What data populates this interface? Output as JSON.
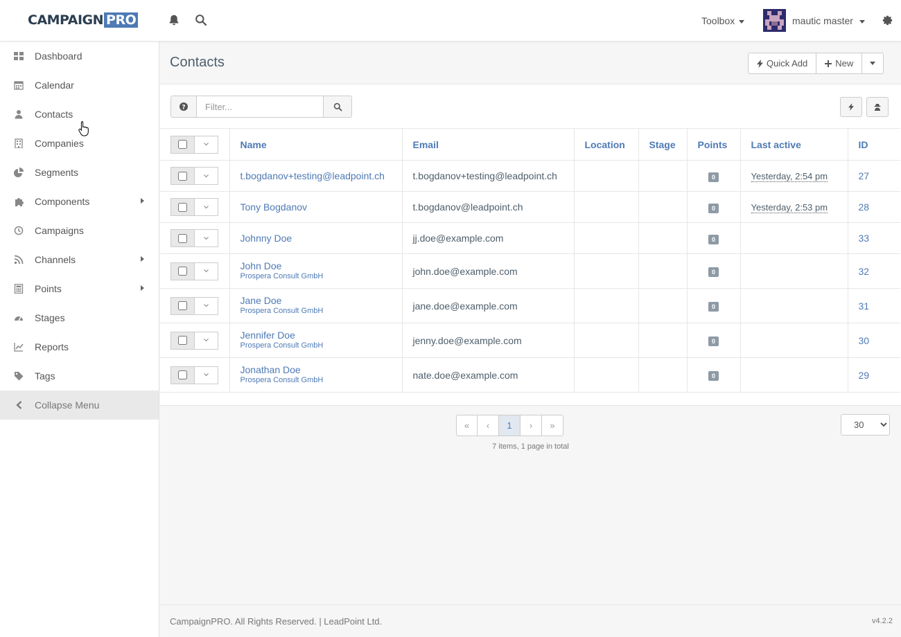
{
  "brand": {
    "name_a": "CAMPAIGN",
    "name_b": "PRO"
  },
  "header": {
    "toolbox_label": "Toolbox",
    "user_name": "mautic master"
  },
  "sidebar": {
    "items": [
      {
        "label": "Dashboard",
        "icon": "dashboard-icon"
      },
      {
        "label": "Calendar",
        "icon": "calendar-icon"
      },
      {
        "label": "Contacts",
        "icon": "user-icon"
      },
      {
        "label": "Companies",
        "icon": "building-icon"
      },
      {
        "label": "Segments",
        "icon": "pie-chart-icon"
      },
      {
        "label": "Components",
        "icon": "puzzle-icon"
      },
      {
        "label": "Campaigns",
        "icon": "clock-icon"
      },
      {
        "label": "Channels",
        "icon": "rss-icon"
      },
      {
        "label": "Points",
        "icon": "calculator-icon"
      },
      {
        "label": "Stages",
        "icon": "tachometer-icon"
      },
      {
        "label": "Reports",
        "icon": "line-chart-icon"
      },
      {
        "label": "Tags",
        "icon": "tag-icon"
      }
    ],
    "collapse_label": "Collapse Menu"
  },
  "page": {
    "title": "Contacts",
    "quick_add_label": "Quick Add",
    "new_label": "New"
  },
  "filter": {
    "placeholder": "Filter..."
  },
  "table": {
    "headers": {
      "name": "Name",
      "email": "Email",
      "location": "Location",
      "stage": "Stage",
      "points": "Points",
      "last_active": "Last active",
      "id": "ID"
    },
    "rows": [
      {
        "name": "t.bogdanov+testing@leadpoint.ch",
        "company": "",
        "email": "t.bogdanov+testing@leadpoint.ch",
        "location": "",
        "stage": "",
        "points": "0",
        "last_active": "Yesterday, 2:54 pm",
        "id": "27"
      },
      {
        "name": "Tony Bogdanov",
        "company": "",
        "email": "t.bogdanov@leadpoint.ch",
        "location": "",
        "stage": "",
        "points": "0",
        "last_active": "Yesterday, 2:53 pm",
        "id": "28"
      },
      {
        "name": "Johnny Doe",
        "company": "",
        "email": "jj.doe@example.com",
        "location": "",
        "stage": "",
        "points": "0",
        "last_active": "",
        "id": "33"
      },
      {
        "name": "John Doe",
        "company": "Prospera Consult GmbH",
        "email": "john.doe@example.com",
        "location": "",
        "stage": "",
        "points": "0",
        "last_active": "",
        "id": "32"
      },
      {
        "name": "Jane Doe",
        "company": "Prospera Consult GmbH",
        "email": "jane.doe@example.com",
        "location": "",
        "stage": "",
        "points": "0",
        "last_active": "",
        "id": "31"
      },
      {
        "name": "Jennifer Doe",
        "company": "Prospera Consult GmbH",
        "email": "jenny.doe@example.com",
        "location": "",
        "stage": "",
        "points": "0",
        "last_active": "",
        "id": "30"
      },
      {
        "name": "Jonathan Doe",
        "company": "Prospera Consult GmbH",
        "email": "nate.doe@example.com",
        "location": "",
        "stage": "",
        "points": "0",
        "last_active": "",
        "id": "29"
      }
    ]
  },
  "pagination": {
    "first": "«",
    "prev": "‹",
    "current": "1",
    "next": "›",
    "last": "»",
    "info": "7 items, 1 page in total",
    "per_page": "30"
  },
  "footer": {
    "copyright": "CampaignPRO. All Rights Reserved. | LeadPoint Ltd.",
    "version": "v4.2.2"
  },
  "colors": {
    "accent": "#4e7ab5",
    "badge": "#8e9aa5"
  }
}
